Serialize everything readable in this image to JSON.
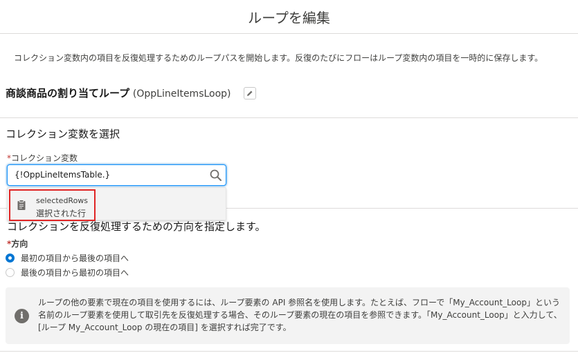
{
  "modal": {
    "title": "ループを編集"
  },
  "description": "コレクション変数内の項目を反復処理するためのループパスを開始します。反復のたびにフローはループ変数内の項目を一時的に保存します。",
  "element": {
    "label": "商談商品の割り当てループ",
    "api_name": "(OppLineItemsLoop)"
  },
  "collection_section": {
    "heading": "コレクション変数を選択"
  },
  "collection_field": {
    "label": "コレクション変数",
    "value": "{!OppLineItemsTable.}",
    "option": {
      "title": "selectedRows",
      "subtitle": "選択された行"
    }
  },
  "direction_section": {
    "heading": "コレクションを反復処理するための方向を指定します。",
    "label": "方向",
    "options": [
      {
        "label": "最初の項目から最後の項目へ",
        "selected": true
      },
      {
        "label": "最後の項目から最初の項目へ",
        "selected": false
      }
    ]
  },
  "info": {
    "text": "ループの他の要素で現在の項目を使用するには、ループ要素の API 参照名を使用します。たとえば、フローで「My_Account_Loop」という名前のループ要素を使用して取引先を反復処理する場合、そのループ要素の現在の項目を参照できます。「My_Account_Loop」と入力して、[ループ My_Account_Loop の現在の項目] を選択すれば完了です。"
  },
  "colors": {
    "accent": "#0176d3",
    "highlight": "#e02424",
    "info_bg": "#f3f3f3"
  }
}
